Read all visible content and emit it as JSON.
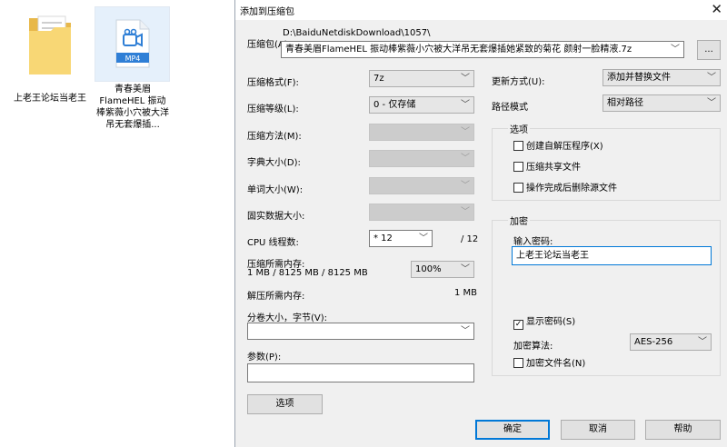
{
  "desktop": {
    "folder_label": "上老王论坛当老王",
    "mp4_badge": "MP4",
    "mp4_label": "青春美眉FlameHEL 振动棒紫薇小穴被大洋吊无套爆插..."
  },
  "dialog": {
    "title": "添加到压缩包",
    "close_glyph": "✕",
    "archive_label": "压缩包(A)",
    "archive_path": "D:\\BaiduNetdiskDownload\\1057\\",
    "archive_name": "青春美眉FlameHEL 振动棒紫薇小穴被大洋吊无套爆插她紧致的菊花 颜射一脸精液.7z",
    "browse_label": "...",
    "format_label": "压缩格式(F):",
    "format_value": "7z",
    "level_label": "压缩等级(L):",
    "level_value": "0 - 仅存储",
    "method_label": "压缩方法(M):",
    "dict_label": "字典大小(D):",
    "word_label": "单词大小(W):",
    "solid_label": "固实数据大小:",
    "cpu_label": "CPU 线程数:",
    "cpu_value": "* 12",
    "cpu_total": "/ 12",
    "mem_label": "压缩所需内存:",
    "mem_values": "1 MB / 8125 MB / 8125 MB",
    "mem_percent": "100%",
    "decomp_label": "解压所需内存:",
    "decomp_value": "1 MB",
    "split_label": "分卷大小，字节(V):",
    "params_label": "参数(P):",
    "options_button": "选项",
    "update_label": "更新方式(U):",
    "update_value": "添加并替换文件",
    "path_label": "路径模式",
    "path_value": "相对路径",
    "options_group": "选项",
    "opt_sfx": "创建自解压程序(X)",
    "opt_shared": "压缩共享文件",
    "opt_delete": "操作完成后删除源文件",
    "encrypt_group": "加密",
    "password_label": "输入密码:",
    "password_value": "上老王论坛当老王",
    "show_password": "显示密码(S)",
    "enc_method_label": "加密算法:",
    "enc_method_value": "AES-256",
    "encrypt_names": "加密文件名(N)",
    "ok_button": "确定",
    "cancel_button": "取消",
    "help_button": "帮助",
    "arrow_glyph": "﹀",
    "check_glyph": "✓"
  },
  "colors": {
    "dialog_bg": "#f0f0f0",
    "accent": "#0078d7",
    "folder": "#f8d775",
    "mp4_blue": "#2f7fd6"
  }
}
